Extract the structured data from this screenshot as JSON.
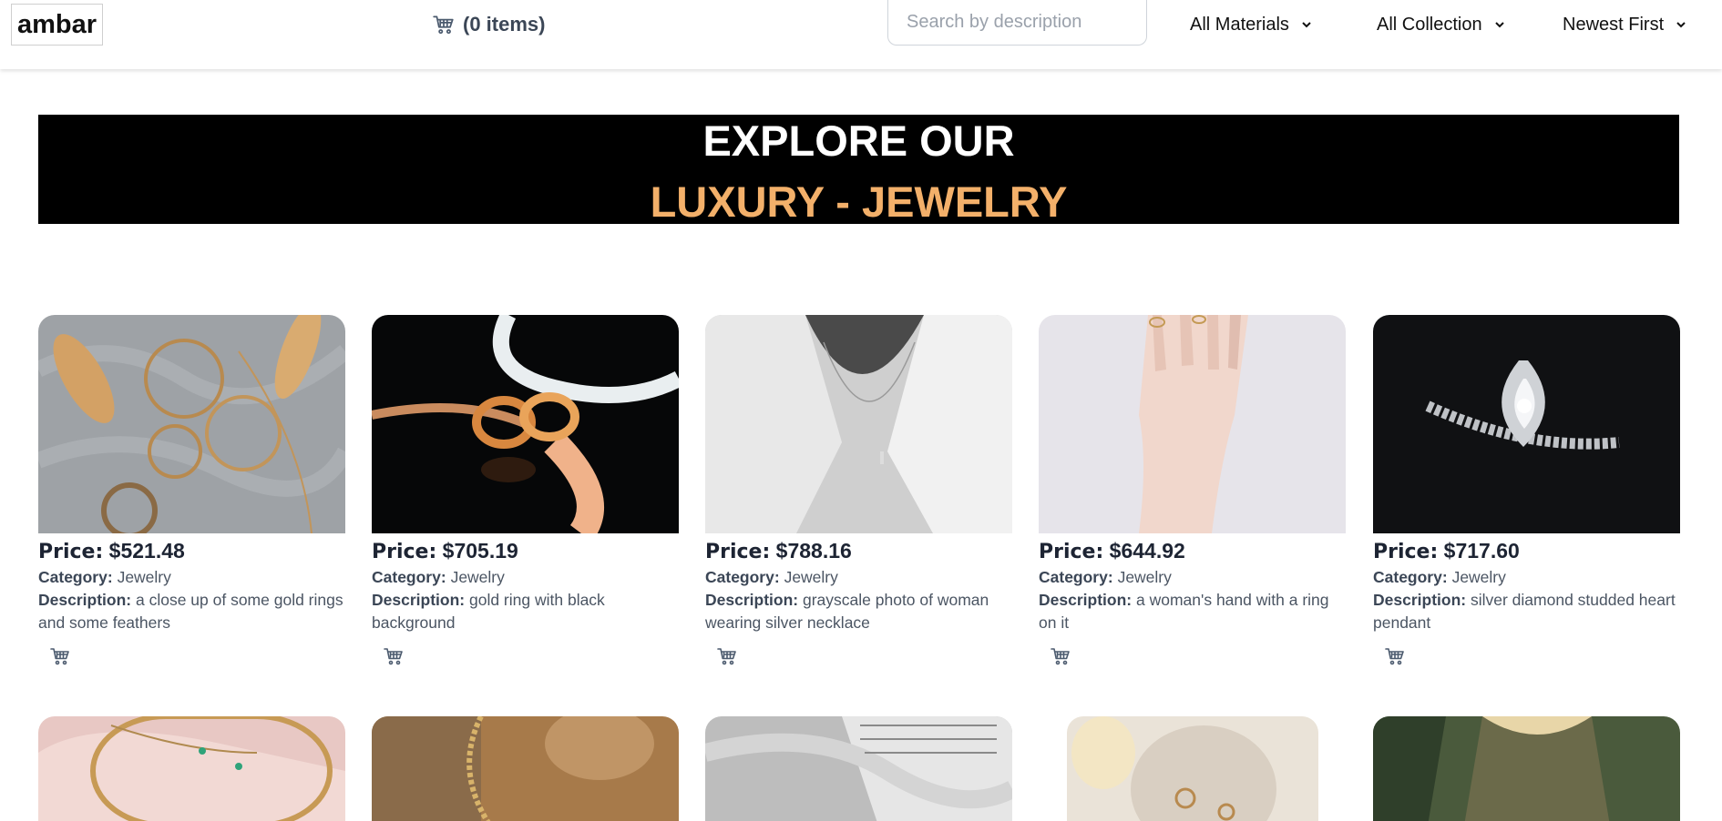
{
  "header": {
    "logo": "ambar",
    "cart_label": "(0 items)",
    "cart_icon": "cart-icon",
    "search_placeholder": "Search by description",
    "filters": {
      "materials": "All Materials",
      "collection": "All Collection",
      "sort": "Newest First"
    }
  },
  "hero": {
    "line1": "EXPLORE OUR",
    "line2": "LUXURY - JEWELRY",
    "accent_color": "#f3b06a"
  },
  "labels": {
    "price": "Price:",
    "category": "Category:",
    "description": "Description:"
  },
  "products": [
    {
      "price": "$521.48",
      "category": "Jewelry",
      "description": "a close up of some gold rings and some feathers"
    },
    {
      "price": "$705.19",
      "category": "Jewelry",
      "description": "gold ring with black background"
    },
    {
      "price": "$788.16",
      "category": "Jewelry",
      "description": "grayscale photo of woman wearing silver necklace"
    },
    {
      "price": "$644.92",
      "category": "Jewelry",
      "description": "a woman's hand with a ring on it"
    },
    {
      "price": "$717.60",
      "category": "Jewelry",
      "description": "silver diamond studded heart pendant"
    }
  ]
}
